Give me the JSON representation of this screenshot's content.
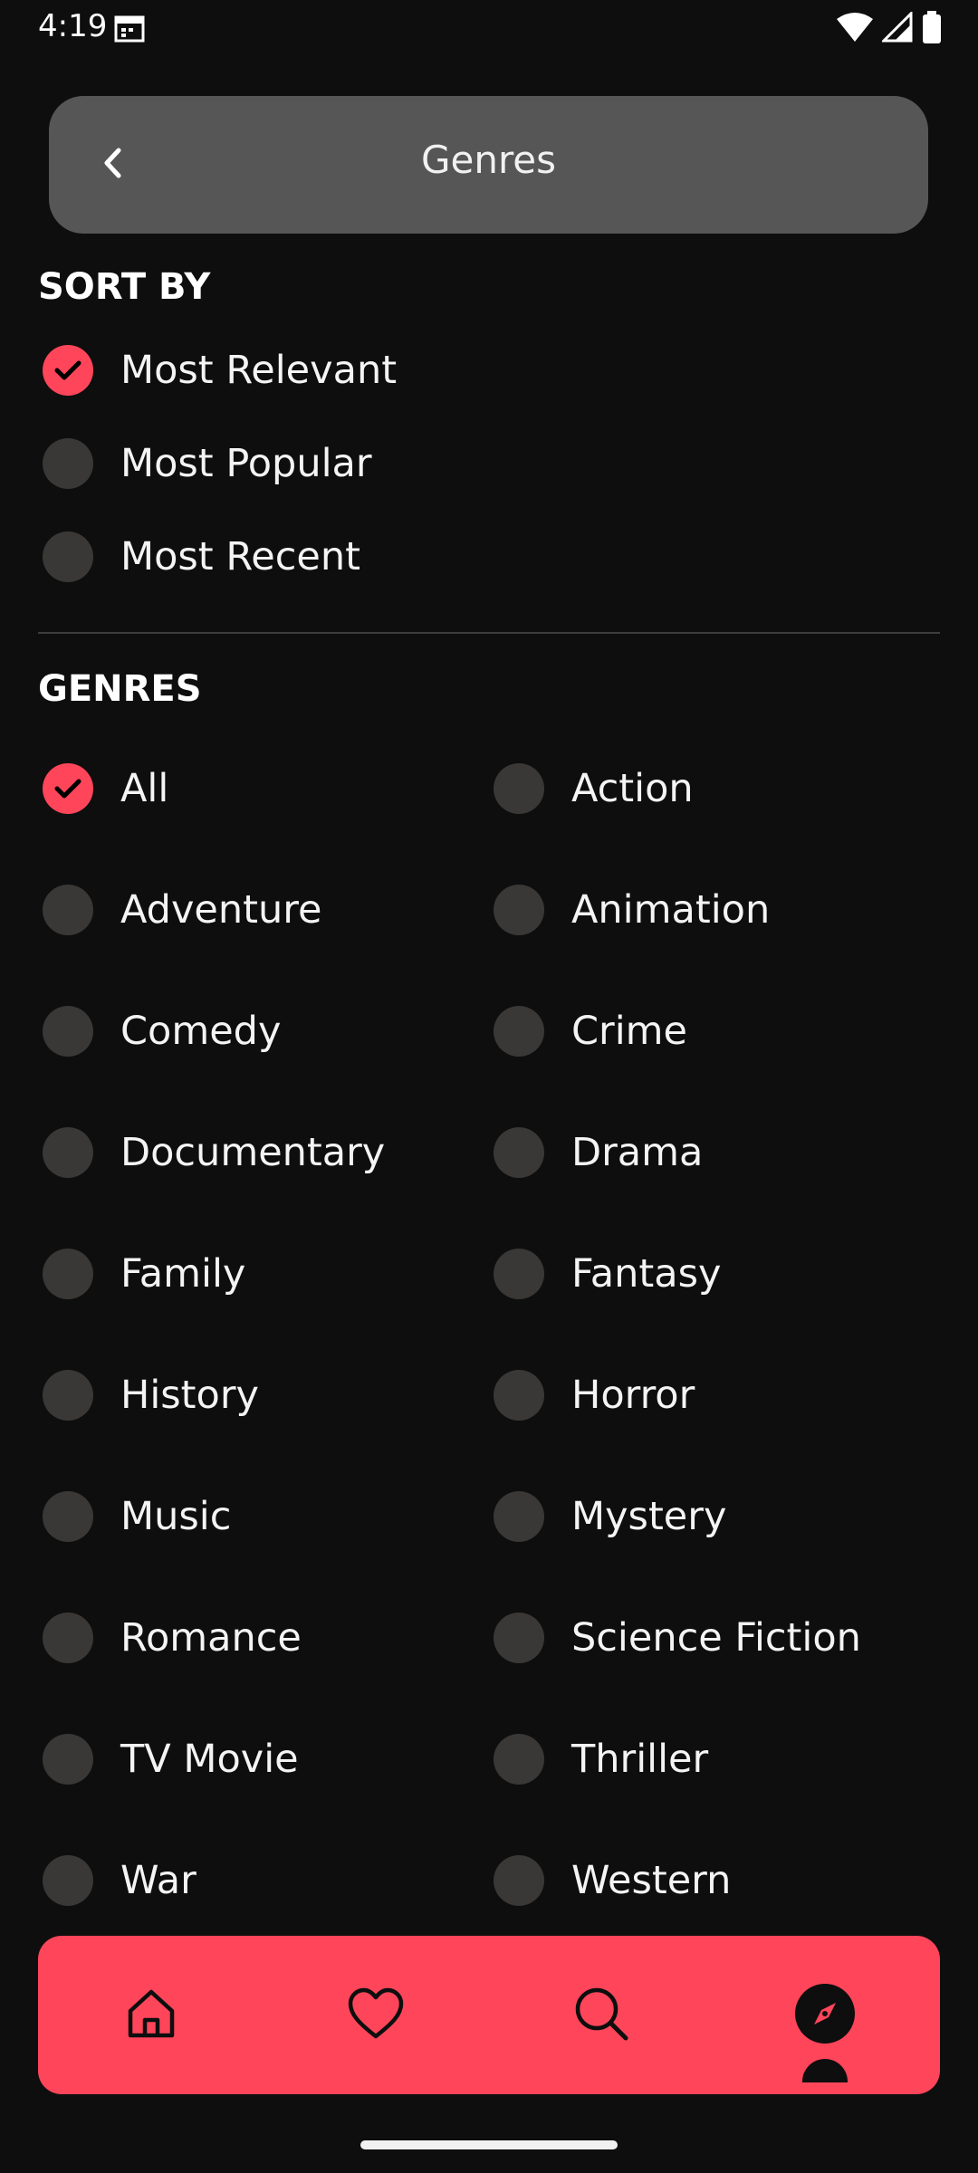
{
  "status_bar": {
    "time": "4:19"
  },
  "header": {
    "title": "Genres"
  },
  "sort_section": {
    "title": "SORT BY",
    "options": [
      {
        "label": "Most Relevant",
        "checked": true
      },
      {
        "label": "Most Popular",
        "checked": false
      },
      {
        "label": "Most Recent",
        "checked": false
      }
    ]
  },
  "genres_section": {
    "title": "GENRES",
    "items": [
      {
        "label": "All",
        "checked": true
      },
      {
        "label": "Action",
        "checked": false
      },
      {
        "label": "Adventure",
        "checked": false
      },
      {
        "label": "Animation",
        "checked": false
      },
      {
        "label": "Comedy",
        "checked": false
      },
      {
        "label": "Crime",
        "checked": false
      },
      {
        "label": "Documentary",
        "checked": false
      },
      {
        "label": "Drama",
        "checked": false
      },
      {
        "label": "Family",
        "checked": false
      },
      {
        "label": "Fantasy",
        "checked": false
      },
      {
        "label": "History",
        "checked": false
      },
      {
        "label": "Horror",
        "checked": false
      },
      {
        "label": "Music",
        "checked": false
      },
      {
        "label": "Mystery",
        "checked": false
      },
      {
        "label": "Romance",
        "checked": false
      },
      {
        "label": "Science Fiction",
        "checked": false
      },
      {
        "label": "TV Movie",
        "checked": false
      },
      {
        "label": "Thriller",
        "checked": false
      },
      {
        "label": "War",
        "checked": false
      },
      {
        "label": "Western",
        "checked": false
      }
    ]
  },
  "bottom_nav": {
    "items": [
      {
        "icon": "home-icon",
        "active": false
      },
      {
        "icon": "heart-icon",
        "active": false
      },
      {
        "icon": "search-icon",
        "active": false
      },
      {
        "icon": "compass-icon",
        "active": true
      }
    ]
  },
  "colors": {
    "accent": "#ff455a",
    "background": "#0e0e0e",
    "header": "#565656",
    "radio_off": "#3a3836"
  }
}
